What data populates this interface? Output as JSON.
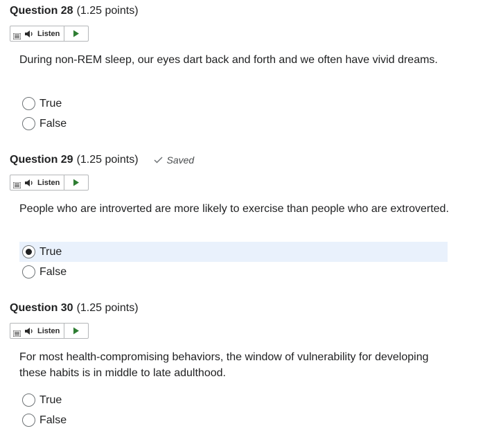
{
  "questions": [
    {
      "title": "Question 28",
      "points": "(1.25 points)",
      "saved": "",
      "listen_label": "Listen",
      "text": "During non-REM sleep, our eyes dart back and forth and we often have vivid dreams.",
      "options": [
        {
          "label": "True",
          "selected": false
        },
        {
          "label": "False",
          "selected": false
        }
      ]
    },
    {
      "title": "Question 29",
      "points": "(1.25 points)",
      "saved": "Saved",
      "listen_label": "Listen",
      "text": "People who are introverted are more likely to exercise than people who are extroverted.",
      "options": [
        {
          "label": "True",
          "selected": true
        },
        {
          "label": "False",
          "selected": false
        }
      ]
    },
    {
      "title": "Question 30",
      "points": "(1.25 points)",
      "saved": "",
      "listen_label": "Listen",
      "text": "For most health-compromising behaviors, the window of vulnerability for developing these habits is in middle to late adulthood.",
      "options": [
        {
          "label": "True",
          "selected": false
        },
        {
          "label": "False",
          "selected": false
        }
      ]
    }
  ],
  "icons": {
    "menu": "listen-menu-icon",
    "speaker": "speaker-icon",
    "play": "play-icon",
    "check": "check-icon"
  },
  "colors": {
    "selected_row": "#e9f1fc",
    "play_green": "#2e7d32"
  }
}
